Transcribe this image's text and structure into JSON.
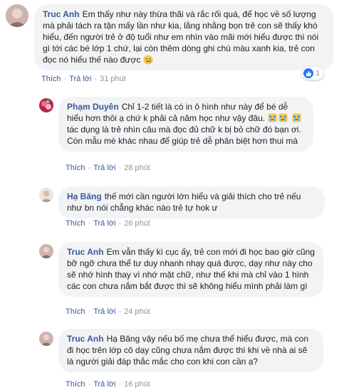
{
  "colors": {
    "author": "#385898",
    "bubble": "#f2f3f5",
    "meta": "#90949c",
    "like_blue": "#2078f4"
  },
  "actions": {
    "like": "Thích",
    "reply": "Trả lời",
    "separator": "·"
  },
  "comments": [
    {
      "author": "Truc Anh",
      "text": "Em thấy như này thừa thãi và rắc rối quá, để học về số lượng mà phải tách ra tận mấy lần như kia, lằng nhằng bọn trẻ con sẽ thấy khó hiểu, đến người trẻ ở độ tuổi như em nhìn vào mãi mới hiểu được thì nói gì tới các bé lớp 1 chứ, lại còn thêm dòng ghi chú màu xanh kia, trẻ con đọc nó hiểu thế nào được",
      "emoji": "sad-face-icon",
      "time": "31 phút",
      "reaction_icon": "like-icon",
      "reaction_count": "1"
    },
    {
      "author": "Phạm Duyên",
      "text_part1": "Chỉ 1-2 tiết là có in ô hình như này để bé dễ hiểu hơn thôi ạ chứ k phải cả năm học như vậy đâu.",
      "text_part2": "tác dụng là trẻ nhìn câu mà đọc đủ chữ k bị bỏ chữ đó bạn ơi. Còn mẫu mè khác nhau để giúp trẻ dễ phân biệt hơn thui mà",
      "emoji": "crying-face-icon",
      "time": "28 phút"
    },
    {
      "author": "Hạ Băng",
      "text": "thế mới cần người lớn hiểu và giải thích cho trẻ nếu như bn nói chẳng khác nào trẻ tự hok ư",
      "time": "26 phút"
    },
    {
      "author": "Truc Anh",
      "text": "Em vẫn thấy kì cục ấy, trẻ con mới đi học bao giờ cũng bỡ ngỡ chưa thể tư duy nhanh nhạy quá được, dạy như này cho sẽ nhớ hình thay vì nhớ mặt chữ, như thế khi mà chỉ vào 1 hình các con chưa nắm bắt được thì sẽ không hiểu mình phải làm gì",
      "time": "24 phút"
    },
    {
      "author": "Truc Anh",
      "text": "Hạ Băng vậy nếu bố mẹ chưa thể hiểu được, mà con đi học trên lớp cô dạy cũng chưa nắm được thì khi về nhà ai sẽ là người giải đáp thắc mắc cho con khi con cần ạ?",
      "time": "16 phút"
    }
  ]
}
